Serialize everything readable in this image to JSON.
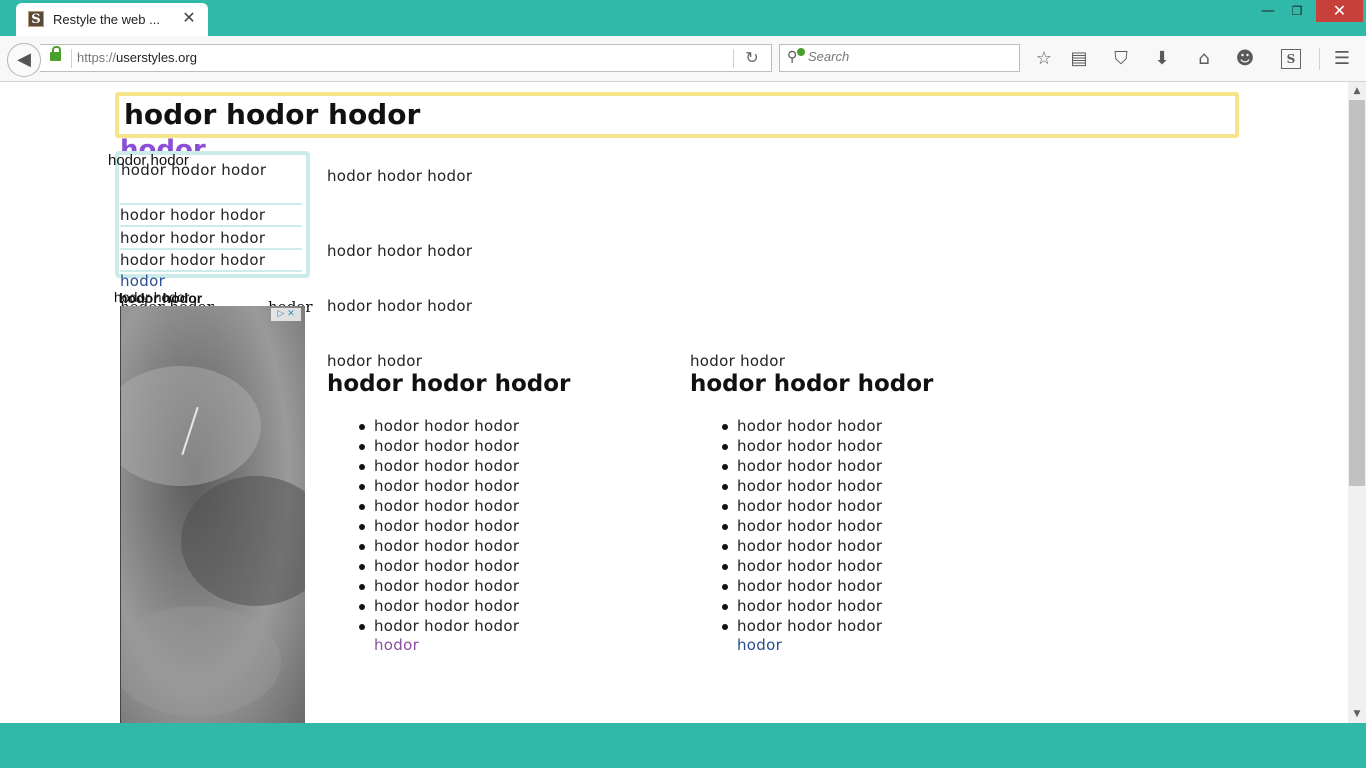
{
  "browser": {
    "tab": {
      "title": "Restyle the web ...",
      "favicon": "S",
      "close": "✕"
    },
    "window_controls": {
      "minimize": "—",
      "maximize": "❐",
      "close": "✕"
    },
    "url": {
      "protocol": "https://",
      "host": "userstyles.org"
    },
    "search": {
      "placeholder": "Search"
    },
    "toolbar": {
      "bookmark_icon": "☆",
      "reading_list_icon": "▤",
      "pocket_icon": "⛉",
      "download_icon": "⬇",
      "home_icon": "⌂",
      "hello_icon": "☻",
      "stylish_icon": "S",
      "menu_icon": "☰"
    }
  },
  "page": {
    "heading": "hodor hodor hodor",
    "purple_text": "hodor",
    "overlap_label": "hodor hodor",
    "sidebar": {
      "first": "hodor hodor hodor",
      "items": [
        "hodor hodor hodor",
        "hodor hodor hodor",
        "hodor hodor hodor"
      ],
      "more_link": "hodor"
    },
    "overlap_lines": {
      "line_a": "hodor hodor",
      "line_b": "hodor hodor",
      "line_c": "hodor hodor",
      "line_d": "hodor"
    },
    "ad": {
      "choices": "▷ ✕"
    },
    "paragraphs": [
      "hodor hodor hodor",
      "hodor hodor hodor",
      "hodor hodor hodor"
    ],
    "columns": [
      {
        "kicker": "hodor hodor",
        "heading": "hodor hodor hodor",
        "items": [
          "hodor hodor hodor",
          "hodor hodor hodor",
          "hodor hodor hodor",
          "hodor hodor hodor",
          "hodor hodor hodor",
          "hodor hodor hodor",
          "hodor hodor hodor",
          "hodor hodor hodor",
          "hodor hodor hodor",
          "hodor hodor hodor",
          "hodor hodor hodor"
        ],
        "more": "hodor"
      },
      {
        "kicker": "hodor hodor",
        "heading": "hodor hodor hodor",
        "items": [
          "hodor hodor hodor",
          "hodor hodor hodor",
          "hodor hodor hodor",
          "hodor hodor hodor",
          "hodor hodor hodor",
          "hodor hodor hodor",
          "hodor hodor hodor",
          "hodor hodor hodor",
          "hodor hodor hodor",
          "hodor hodor hodor",
          "hodor hodor hodor"
        ],
        "more": "hodor"
      }
    ]
  },
  "colors": {
    "accent": "#30b8a8",
    "heading_border": "#f5e48a",
    "sidebar_border": "#cbeceb",
    "purple": "#8a4fd4",
    "link": "#2a4d8f"
  }
}
